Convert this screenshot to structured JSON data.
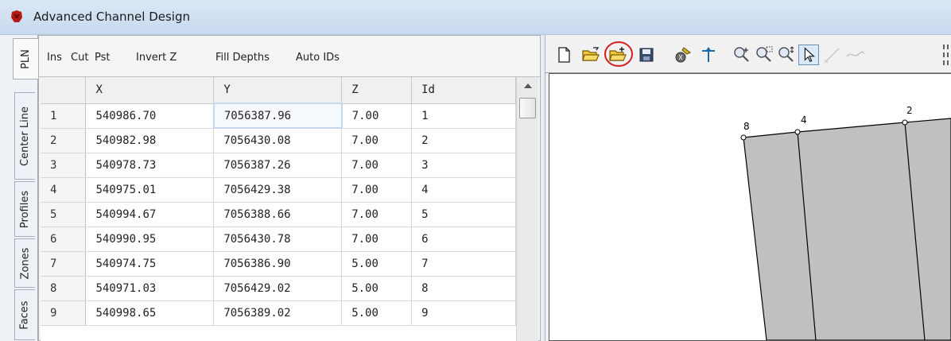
{
  "window": {
    "title": "Advanced Channel Design"
  },
  "tabs": [
    {
      "label": "PLN"
    },
    {
      "label": "Center Line"
    },
    {
      "label": "Profiles"
    },
    {
      "label": "Zones"
    },
    {
      "label": "Faces"
    }
  ],
  "toolbar": {
    "ins": "Ins",
    "cut": "Cut",
    "pst": "Pst",
    "invert_z": "Invert Z",
    "fill_depths": "Fill Depths",
    "auto_ids": "Auto IDs"
  },
  "table": {
    "columns": [
      "X",
      "Y",
      "Z",
      "Id"
    ],
    "rows": [
      {
        "n": "1",
        "x": "540986.70",
        "y": "7056387.96",
        "z": "7.00",
        "id": "1"
      },
      {
        "n": "2",
        "x": "540982.98",
        "y": "7056430.08",
        "z": "7.00",
        "id": "2"
      },
      {
        "n": "3",
        "x": "540978.73",
        "y": "7056387.26",
        "z": "7.00",
        "id": "3"
      },
      {
        "n": "4",
        "x": "540975.01",
        "y": "7056429.38",
        "z": "7.00",
        "id": "4"
      },
      {
        "n": "5",
        "x": "540994.67",
        "y": "7056388.66",
        "z": "7.00",
        "id": "5"
      },
      {
        "n": "6",
        "x": "540990.95",
        "y": "7056430.78",
        "z": "7.00",
        "id": "6"
      },
      {
        "n": "7",
        "x": "540974.75",
        "y": "7056386.90",
        "z": "5.00",
        "id": "7"
      },
      {
        "n": "8",
        "x": "540971.03",
        "y": "7056429.02",
        "z": "5.00",
        "id": "8"
      },
      {
        "n": "9",
        "x": "540998.65",
        "y": "7056389.02",
        "z": "5.00",
        "id": "9"
      }
    ]
  },
  "canvas": {
    "point_labels": [
      "8",
      "4",
      "2"
    ]
  },
  "icons": {
    "new": "new-file-icon",
    "open": "open-folder-icon",
    "import": "import-folder-icon",
    "save": "save-icon",
    "settings": "settings-tool-icon",
    "invert": "invert-arrow-icon",
    "zoom_in_out": "zoom-in-out-icon",
    "zoom_window": "zoom-window-icon",
    "zoom_pan": "zoom-pan-icon",
    "select": "select-pointer-icon",
    "line": "line-tool-icon",
    "curve": "curve-tool-icon"
  },
  "colors": {
    "highlight_circle": "#d42020",
    "polygon_fill": "#c0c0c0"
  }
}
